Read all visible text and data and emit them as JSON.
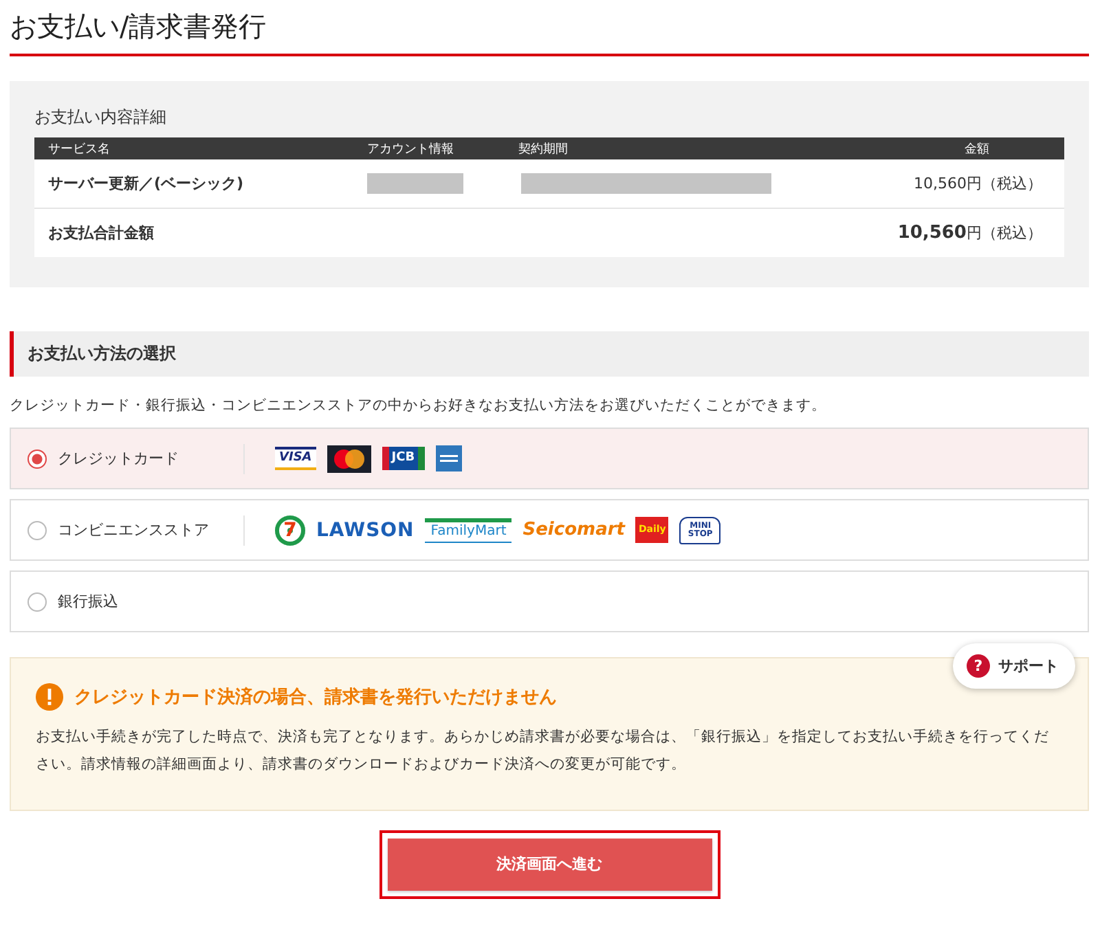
{
  "page_title": "お支払い/請求書発行",
  "details": {
    "heading": "お支払い内容詳細",
    "columns": [
      "サービス名",
      "アカウント情報",
      "契約期間",
      "金額"
    ],
    "rows": [
      {
        "kind": "item",
        "name": "サーバー更新／(ベーシック)",
        "amount": "10,560円（税込）"
      },
      {
        "kind": "total",
        "name": "お支払合計金額",
        "amount": "**10,560**円（税込）"
      }
    ]
  },
  "method_section": {
    "heading": "お支払い方法の選択",
    "description": "クレジットカード・銀行振込・コンビニエンスストアの中からお好きなお支払い方法をお選びいただくことができます。",
    "methods": [
      {
        "label": "クレジットカード",
        "selected": true,
        "logos": [
          {
            "kind": "visa",
            "text": "VISA"
          },
          {
            "kind": "mastercard"
          },
          {
            "kind": "jcb",
            "text": "JCB"
          },
          {
            "kind": "amex"
          }
        ]
      },
      {
        "label": "コンビニエンスストア",
        "selected": false,
        "logos": [
          {
            "kind": "seven",
            "text": "7"
          },
          {
            "kind": "lawson",
            "text": "LAWSON"
          },
          {
            "kind": "familymart",
            "text": "FamilyMart"
          },
          {
            "kind": "seicomart",
            "text": "Seicomart"
          },
          {
            "kind": "daily",
            "text": "Daily"
          },
          {
            "kind": "ministop",
            "text": "MINI STOP"
          }
        ]
      },
      {
        "label": "銀行振込",
        "selected": false
      }
    ]
  },
  "notice": {
    "title": "クレジットカード決済の場合、請求書を発行いただけません",
    "body": "お支払い手続きが完了した時点で、決済も完了となります。あらかじめ請求書が必要な場合は、「銀行振込」を指定してお支払い手続きを行ってください。請求情報の詳細画面より、請求書のダウンロードおよびカード決済への変更が可能です。"
  },
  "support_button": {
    "icon_text": "?",
    "label": "サポート"
  },
  "submit_button": "決済画面へ進む"
}
